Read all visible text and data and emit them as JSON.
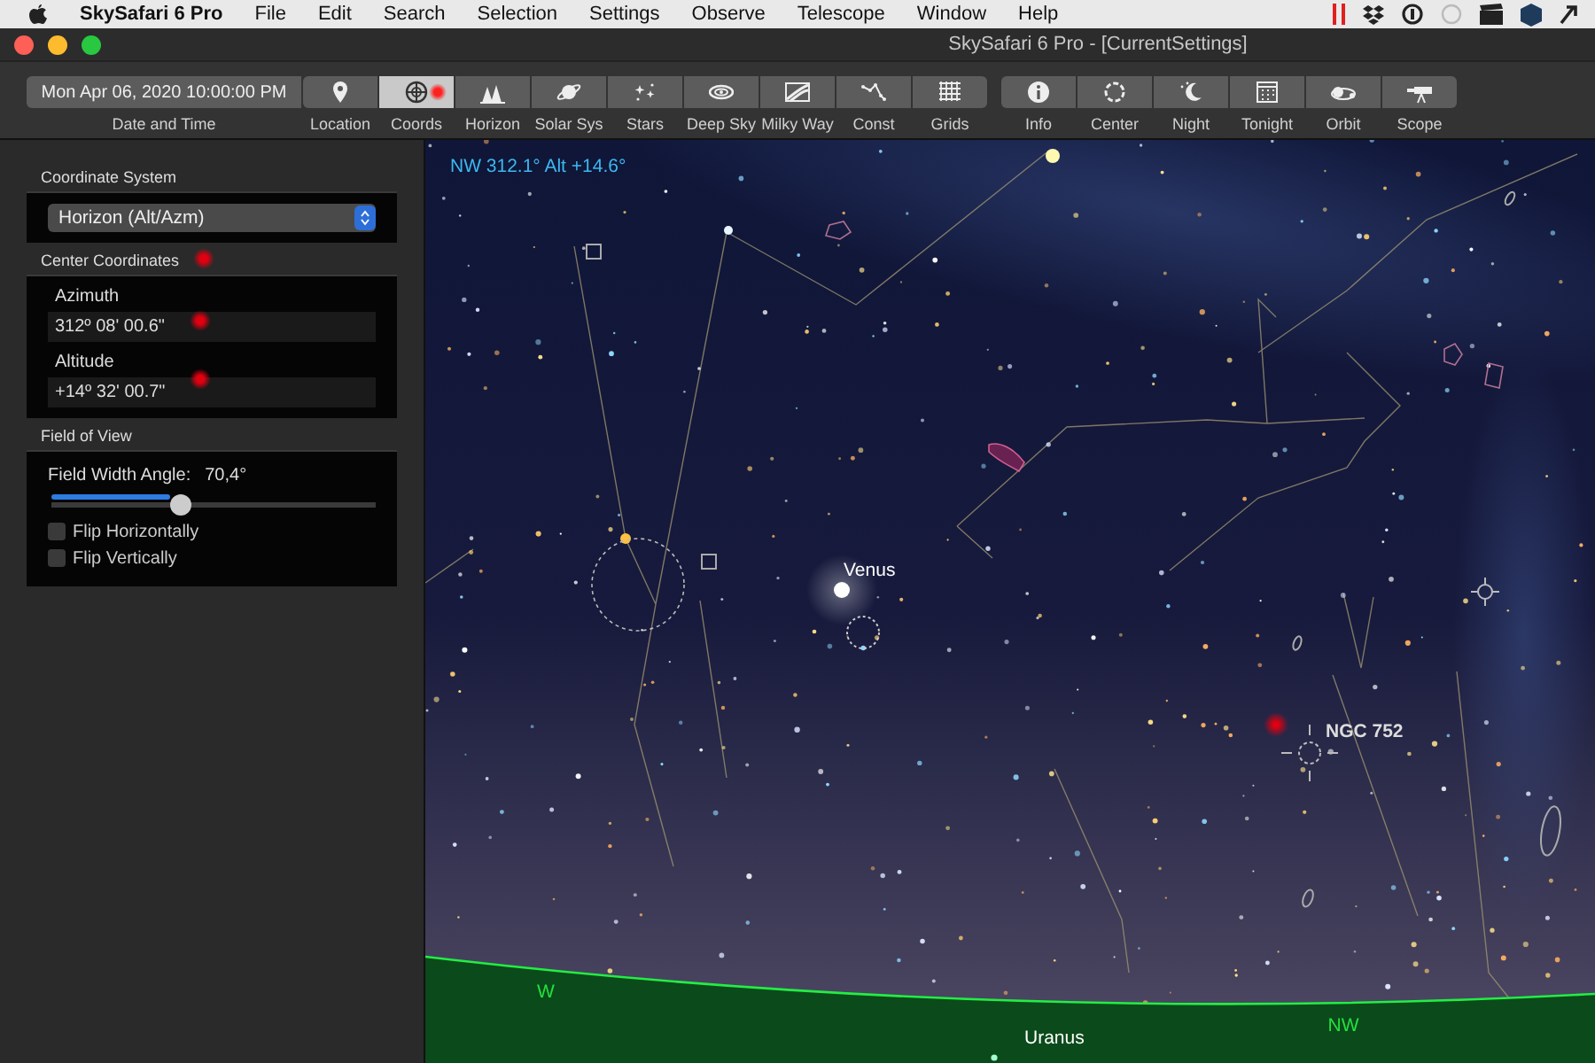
{
  "menu_bar": {
    "app_name": "SkySafari 6 Pro",
    "items": [
      "File",
      "Edit",
      "Search",
      "Selection",
      "Settings",
      "Observe",
      "Telescope",
      "Window",
      "Help"
    ]
  },
  "window": {
    "title": "SkySafari 6 Pro - [CurrentSettings]"
  },
  "toolbar": {
    "date_time": {
      "value": "Mon Apr 06, 2020  10:00:00 PM",
      "label": "Date and Time"
    },
    "groups": [
      [
        {
          "label": "Location",
          "selected": false
        },
        {
          "label": "Coords",
          "selected": true
        },
        {
          "label": "Horizon",
          "selected": false
        },
        {
          "label": "Solar Sys",
          "selected": false
        },
        {
          "label": "Stars",
          "selected": false
        },
        {
          "label": "Deep Sky",
          "selected": false
        },
        {
          "label": "Milky Way",
          "selected": false
        },
        {
          "label": "Const",
          "selected": false
        },
        {
          "label": "Grids",
          "selected": false
        }
      ],
      [
        {
          "label": "Info",
          "selected": false
        },
        {
          "label": "Center",
          "selected": false
        },
        {
          "label": "Night",
          "selected": false
        },
        {
          "label": "Tonight",
          "selected": false
        },
        {
          "label": "Orbit",
          "selected": false
        },
        {
          "label": "Scope",
          "selected": false
        }
      ]
    ]
  },
  "sidebar": {
    "coordinate_system": {
      "heading": "Coordinate System",
      "value": "Horizon (Alt/Azm)"
    },
    "center_coordinates": {
      "heading": "Center Coordinates",
      "fields": [
        {
          "label": "Azimuth",
          "value": "312º 08' 00.6\""
        },
        {
          "label": "Altitude",
          "value": "+14º 32' 00.7\""
        }
      ]
    },
    "field_of_view": {
      "heading": "Field of View",
      "label": "Field Width Angle:",
      "reading": "70,4°",
      "level": 0.39,
      "checkboxes": [
        {
          "label": "Flip Horizontally",
          "checked": false
        },
        {
          "label": "Flip Vertically",
          "checked": false
        }
      ]
    }
  },
  "sky_map": {
    "readout": "NW 312.1° Alt +14.6°",
    "objects": [
      {
        "name": "Venus",
        "kind": "planet"
      },
      {
        "name": "NGC 752",
        "kind": "cluster"
      },
      {
        "name": "Uranus",
        "kind": "planet"
      }
    ],
    "compass": [
      "W",
      "NW"
    ]
  }
}
